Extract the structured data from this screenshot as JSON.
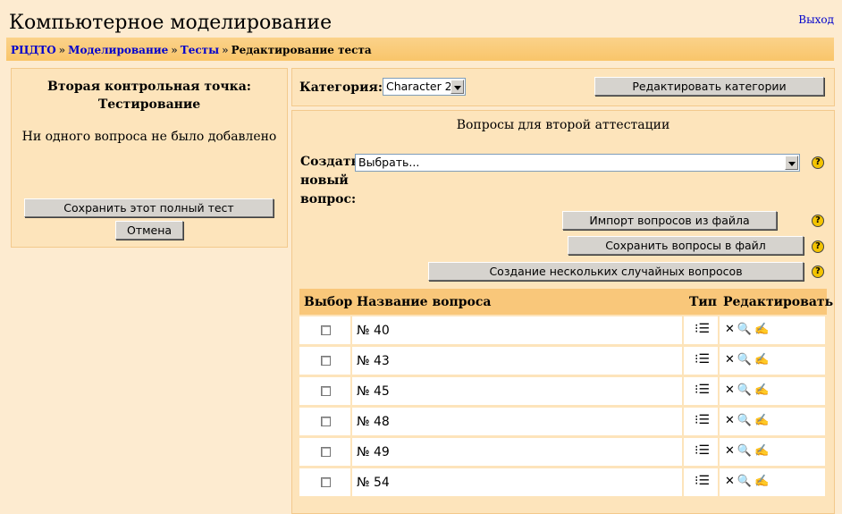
{
  "header": {
    "site_title": "Компьютерное моделирование",
    "logout": "Выход"
  },
  "breadcrumb": {
    "items": [
      "РЦДТО",
      "Моделирование",
      "Тесты",
      "Редактирование теста"
    ],
    "sep": "»"
  },
  "left": {
    "title_line1": "Вторая контрольная точка:",
    "title_line2": "Тестирование",
    "message": "Ни одного вопроса не было добавлено",
    "save_button": "Сохранить этот полный тест",
    "cancel_button": "Отмена"
  },
  "category": {
    "label": "Категория:",
    "selected": "Character 2",
    "edit_button": "Редактировать категории"
  },
  "questions": {
    "title": "Вопросы для второй аттестации",
    "create_label_1": "Создать",
    "create_label_2": "новый",
    "create_label_3": "вопрос:",
    "create_select": "Выбрать...",
    "import_button": "Импорт вопросов из файла",
    "export_button": "Сохранить вопросы в файл",
    "random_button": "Создание нескольких случайных вопросов",
    "help_glyph": "?",
    "columns": [
      "Выбор",
      "Название вопроса",
      "Тип",
      "Редактировать"
    ],
    "rows": [
      {
        "name": "№ 40"
      },
      {
        "name": "№ 43"
      },
      {
        "name": "№ 45"
      },
      {
        "name": "№ 48"
      },
      {
        "name": "№ 49"
      },
      {
        "name": "№ 54"
      }
    ],
    "type_glyph": "⁝☰",
    "icons": {
      "delete": "✕",
      "preview": "🔍",
      "edit": "✍"
    }
  },
  "colors": {
    "bg": "#fdebd0",
    "nav": "#f9c56a",
    "header_row": "#f9c77a",
    "link": "#0000cc"
  }
}
